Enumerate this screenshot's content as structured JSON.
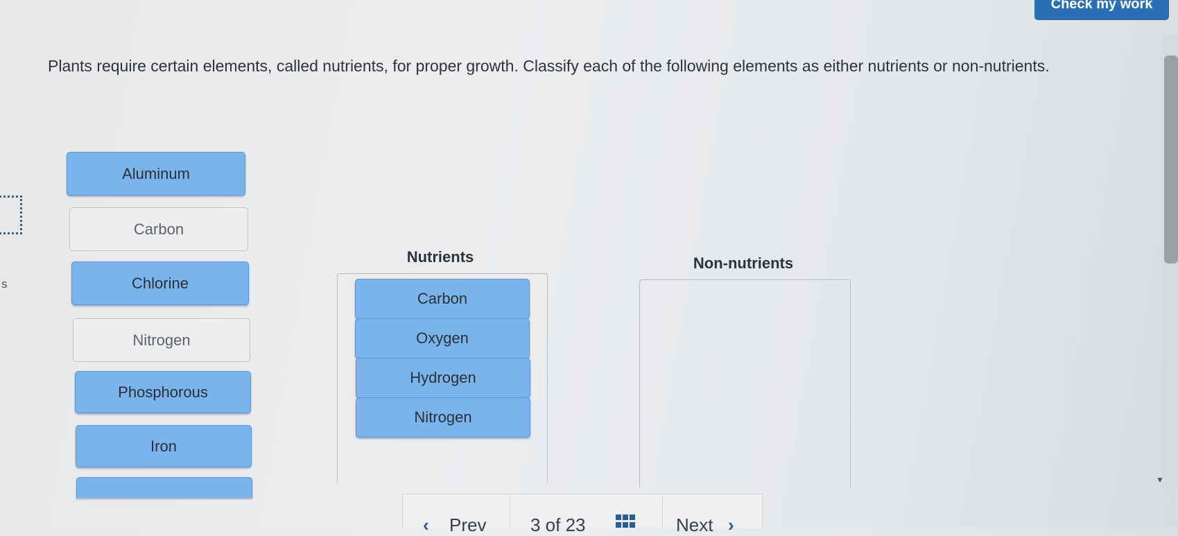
{
  "header": {
    "check_label": "Check my work"
  },
  "question": {
    "text": "Plants require certain elements, called nutrients, for proper growth. Classify each of the following elements as either nutrients or non-nutrients."
  },
  "side": {
    "letter": "s"
  },
  "source_tiles": [
    {
      "label": "Aluminum",
      "state": "active"
    },
    {
      "label": "Carbon",
      "state": "used"
    },
    {
      "label": "Chlorine",
      "state": "active"
    },
    {
      "label": "Nitrogen",
      "state": "used"
    },
    {
      "label": "Phosphorous",
      "state": "active"
    },
    {
      "label": "Iron",
      "state": "active"
    }
  ],
  "zones": {
    "nutrients": {
      "label": "Nutrients",
      "items": [
        "Carbon",
        "Oxygen",
        "Hydrogen",
        "Nitrogen"
      ]
    },
    "non_nutrients": {
      "label": "Non-nutrients",
      "items": []
    }
  },
  "footer": {
    "prev_label": "Prev",
    "page_text": "3 of 23",
    "next_label": "Next"
  },
  "icons": {
    "prev": "chevron-left-icon",
    "next": "chevron-right-icon",
    "grid": "grid-icon",
    "scroll_down": "triangle-down-icon"
  },
  "colors": {
    "tile_active": "#79b5ec",
    "tile_used": "#eceeef",
    "primary_button": "#2a6fb3"
  }
}
